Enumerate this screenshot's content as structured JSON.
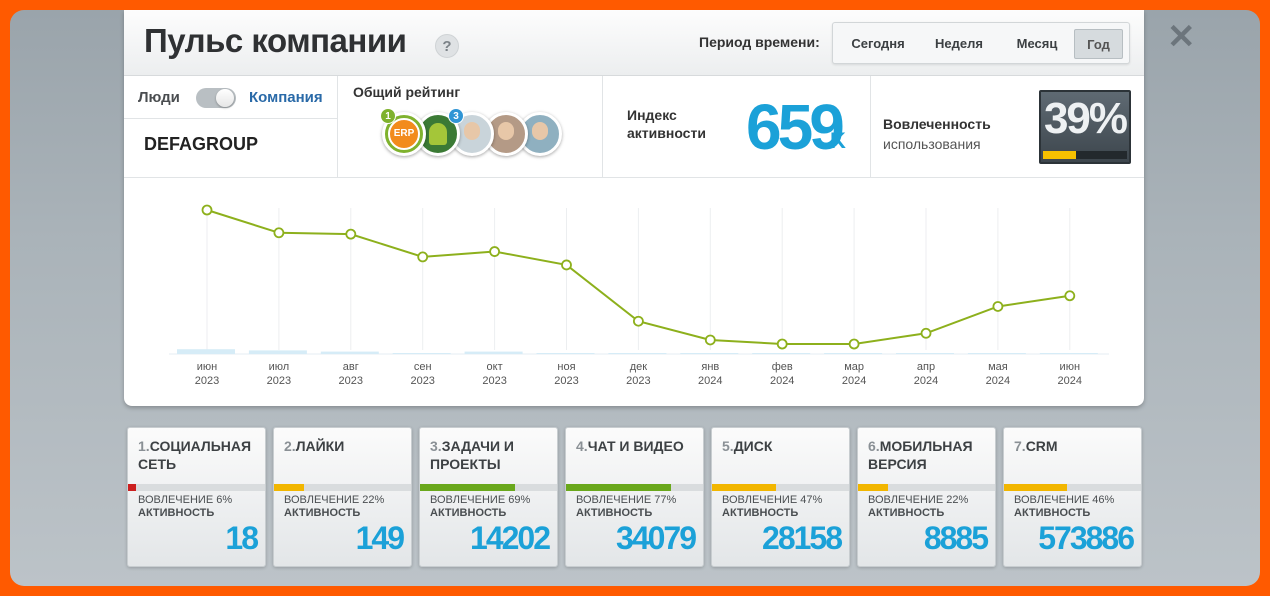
{
  "header": {
    "title": "Пульс компании",
    "help_icon": "question-mark-icon",
    "period_label": "Период времени:",
    "periods": [
      {
        "label": "Сегодня",
        "active": false
      },
      {
        "label": "Неделя",
        "active": false
      },
      {
        "label": "Месяц",
        "active": false
      },
      {
        "label": "Год",
        "active": true
      }
    ],
    "close_icon": "close-icon"
  },
  "scope": {
    "people_label": "Люди",
    "company_label": "Компания",
    "company_name": "DEFAGROUP"
  },
  "rating": {
    "title": "Общий рейтинг",
    "avatars": [
      {
        "name": "erp-avatar",
        "text": "ERP",
        "color": "#7fb22e",
        "badge": "1",
        "badge_color": "#7fb22e"
      },
      {
        "name": "android-avatar",
        "text": "",
        "color": "#3b7a35",
        "badge": "",
        "badge_color": ""
      },
      {
        "name": "user-avatar-3",
        "text": "",
        "color": "#c9d4da",
        "badge": "3",
        "badge_color": "#2f95d5"
      },
      {
        "name": "user-avatar-4",
        "text": "",
        "color": "#b49a86",
        "badge": "",
        "badge_color": ""
      },
      {
        "name": "user-avatar-5",
        "text": "",
        "color": "#8fb0c0",
        "badge": "",
        "badge_color": ""
      }
    ]
  },
  "activity": {
    "label_line1": "Индекс",
    "label_line2": "активности",
    "value": "659",
    "unit": "K"
  },
  "engagement": {
    "title": "Вовлеченность",
    "subtitle": "использования",
    "value": "39%",
    "fraction": 0.39
  },
  "chart_data": {
    "type": "line",
    "x": [
      "июн 2023",
      "июл 2023",
      "авг 2023",
      "сен 2023",
      "окт 2023",
      "ноя 2023",
      "дек 2023",
      "янв 2024",
      "фев 2024",
      "мар 2024",
      "апр 2024",
      "мая 2024",
      "июн 2024"
    ],
    "x_month": [
      "июн",
      "июл",
      "авг",
      "сен",
      "окт",
      "ноя",
      "дек",
      "янв",
      "фев",
      "мар",
      "апр",
      "мая",
      "июн"
    ],
    "x_year": [
      "2023",
      "2023",
      "2023",
      "2023",
      "2023",
      "2023",
      "2023",
      "2024",
      "2024",
      "2024",
      "2024",
      "2024",
      "2024"
    ],
    "series": [
      {
        "values": [
          100,
          83,
          82,
          65,
          69,
          59,
          17,
          3,
          0,
          0,
          8,
          28,
          36
        ],
        "color": "#8db01c"
      },
      {
        "values": [
          4,
          3,
          2,
          0.5,
          2,
          0.5,
          0.3,
          0.2,
          0.2,
          0.2,
          0.2,
          0.3,
          0.3
        ],
        "color": "#d6ecf7",
        "style": "bars"
      }
    ],
    "ylim": [
      0,
      100
    ],
    "grid": "vertical"
  },
  "tools": [
    {
      "num": "1.",
      "title": "Социальная сеть",
      "engagement": "Вовлечение 6%",
      "eng_fraction": 0.06,
      "bar_color": "#cc1f1f",
      "activity": "Активность",
      "value": "18"
    },
    {
      "num": "2.",
      "title": "Лайки",
      "engagement": "Вовлечение 22%",
      "eng_fraction": 0.22,
      "bar_color": "#f2b600",
      "activity": "Активность",
      "value": "149"
    },
    {
      "num": "3.",
      "title": "Задачи и проекты",
      "engagement": "Вовлечение 69%",
      "eng_fraction": 0.69,
      "bar_color": "#6aa81c",
      "activity": "Активность",
      "value": "14202"
    },
    {
      "num": "4.",
      "title": "Чат и видео",
      "engagement": "Вовлечение 77%",
      "eng_fraction": 0.77,
      "bar_color": "#6aa81c",
      "activity": "Активность",
      "value": "34079"
    },
    {
      "num": "5.",
      "title": "Диск",
      "engagement": "Вовлечение 47%",
      "eng_fraction": 0.47,
      "bar_color": "#f2b600",
      "activity": "Активность",
      "value": "28158"
    },
    {
      "num": "6.",
      "title": "Мобильная версия",
      "engagement": "Вовлечение 22%",
      "eng_fraction": 0.22,
      "bar_color": "#f2b600",
      "activity": "Активность",
      "value": "8885"
    },
    {
      "num": "7.",
      "title": "CRM",
      "engagement": "Вовлечение 46%",
      "eng_fraction": 0.46,
      "bar_color": "#f2b600",
      "activity": "Активность",
      "value": "573886"
    }
  ]
}
